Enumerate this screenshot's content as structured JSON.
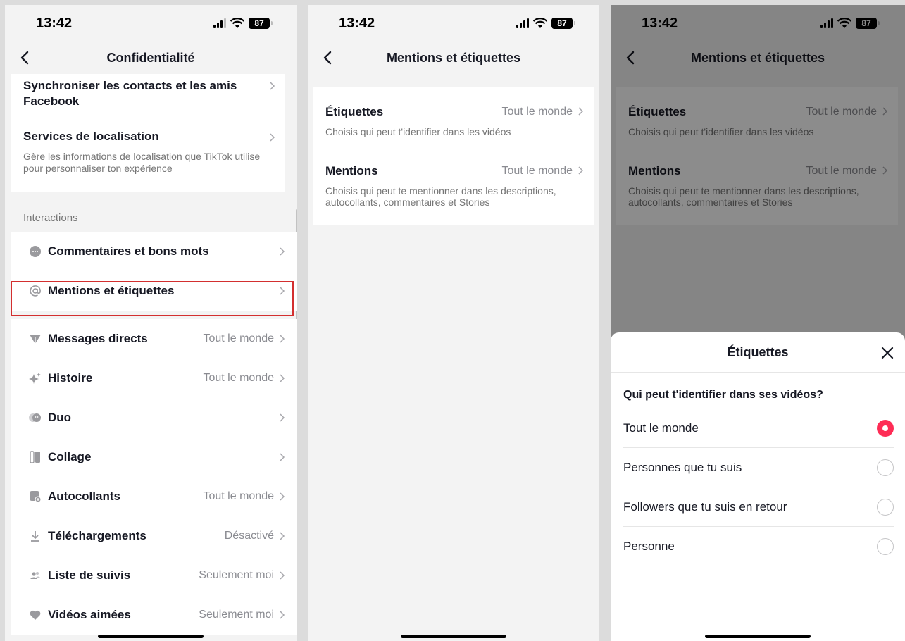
{
  "status": {
    "time": "13:42",
    "battery": "87"
  },
  "panel1": {
    "title": "Confidentialité",
    "top_items": [
      {
        "label": "Synchroniser les contacts et les amis Facebook"
      },
      {
        "label": "Services de localisation",
        "description": "Gère les informations de localisation que TikTok utilise pour personnaliser ton expérience"
      }
    ],
    "section_header": "Interactions",
    "items": [
      {
        "label": "Commentaires et bons mots",
        "value": "",
        "icon": "comment-bubble-icon"
      },
      {
        "label": "Mentions et étiquettes",
        "value": "",
        "icon": "at-sign-icon"
      },
      {
        "label": "Messages directs",
        "value": "Tout le monde",
        "icon": "send-icon"
      },
      {
        "label": "Histoire",
        "value": "Tout le monde",
        "icon": "sparkle-icon"
      },
      {
        "label": "Duo",
        "value": "",
        "icon": "duet-icon"
      },
      {
        "label": "Collage",
        "value": "",
        "icon": "stitch-icon"
      },
      {
        "label": "Autocollants",
        "value": "Tout le monde",
        "icon": "sticker-icon"
      },
      {
        "label": "Téléchargements",
        "value": "Désactivé",
        "icon": "download-icon"
      },
      {
        "label": "Liste de suivis",
        "value": "Seulement moi",
        "icon": "following-list-icon"
      },
      {
        "label": "Vidéos aimées",
        "value": "Seulement moi",
        "icon": "heart-icon"
      }
    ],
    "highlight_color": "#d32f2f"
  },
  "panel2": {
    "title": "Mentions et étiquettes",
    "items": [
      {
        "label": "Étiquettes",
        "value": "Tout le monde",
        "description": "Choisis qui peut t'identifier dans les vidéos"
      },
      {
        "label": "Mentions",
        "value": "Tout le monde",
        "description": "Choisis qui peut te mentionner dans les descriptions, autocollants, commentaires et Stories"
      }
    ]
  },
  "panel3": {
    "sheet_title": "Étiquettes",
    "question": "Qui peut t'identifier dans ses vidéos?",
    "options": [
      {
        "label": "Tout le monde",
        "selected": true
      },
      {
        "label": "Personnes que tu suis",
        "selected": false
      },
      {
        "label": "Followers que tu suis en retour",
        "selected": false
      },
      {
        "label": "Personne",
        "selected": false
      }
    ],
    "accent_color": "#fe2c55"
  }
}
